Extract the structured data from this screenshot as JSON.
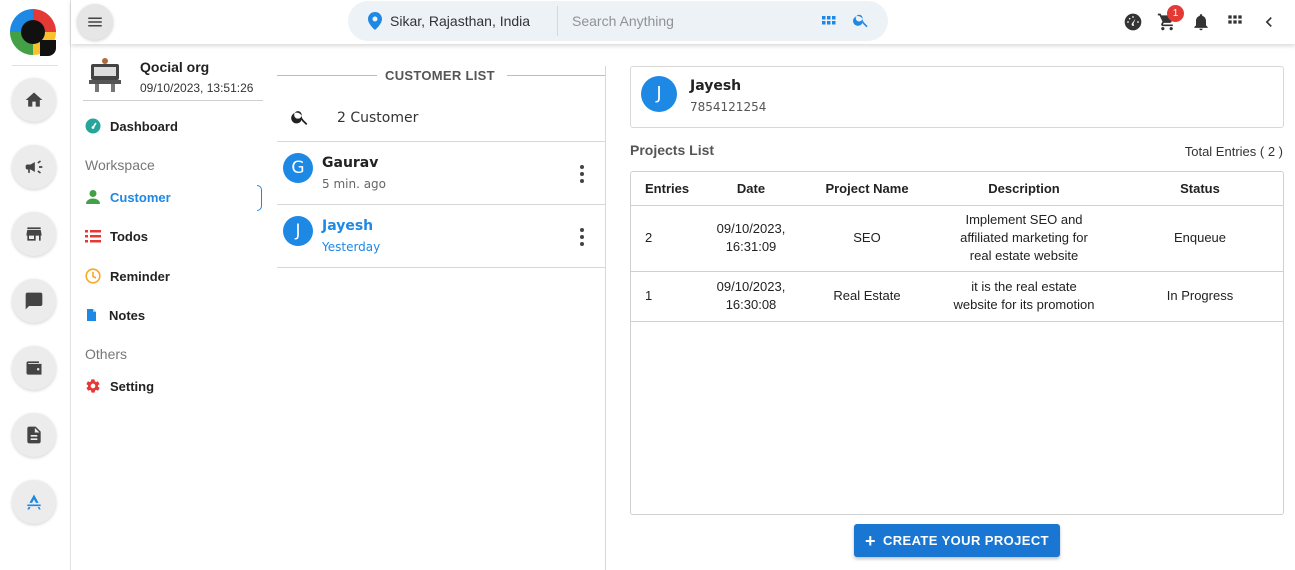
{
  "topbar": {
    "location": "Sikar, Rajasthan, India",
    "search_placeholder": "Search Anything",
    "cart_count": "1"
  },
  "sidebar": {
    "org_name": "Qocial org",
    "org_timestamp": "09/10/2023, 13:51:26",
    "dashboard": "Dashboard",
    "workspace_heading": "Workspace",
    "items": [
      {
        "label": "Customer",
        "active": true
      },
      {
        "label": "Todos"
      },
      {
        "label": "Reminder"
      },
      {
        "label": "Notes"
      }
    ],
    "others_heading": "Others",
    "setting": "Setting"
  },
  "customer_list": {
    "title": "CUSTOMER LIST",
    "count": "2 Customer",
    "customers": [
      {
        "initial": "G",
        "name": "Gaurav",
        "time": "5 min. ago"
      },
      {
        "initial": "J",
        "name": "Jayesh",
        "time": "Yesterday",
        "selected": true
      }
    ]
  },
  "customer_detail": {
    "initial": "J",
    "name": "Jayesh",
    "phone": "7854121254"
  },
  "projects": {
    "title": "Projects List",
    "total": "Total Entries ( 2 )",
    "headers": [
      "Entries",
      "Date",
      "Project Name",
      "Description",
      "Status"
    ],
    "rows": [
      {
        "entry": "2",
        "date_line1": "09/10/2023,",
        "date_line2": "16:31:09",
        "name": "SEO",
        "desc_line1": "Implement SEO and",
        "desc_line2": "affiliated marketing for",
        "desc_line3": "real estate website",
        "status": "Enqueue"
      },
      {
        "entry": "1",
        "date_line1": "09/10/2023,",
        "date_line2": "16:30:08",
        "name": "Real Estate",
        "desc_line1": "it is the real estate",
        "desc_line2": "website for its promotion",
        "status": "In Progress"
      }
    ]
  },
  "create_button": "CREATE YOUR PROJECT",
  "colors": {
    "accent": "#1e88e5",
    "button": "#1976d2",
    "badge": "#e53935"
  }
}
